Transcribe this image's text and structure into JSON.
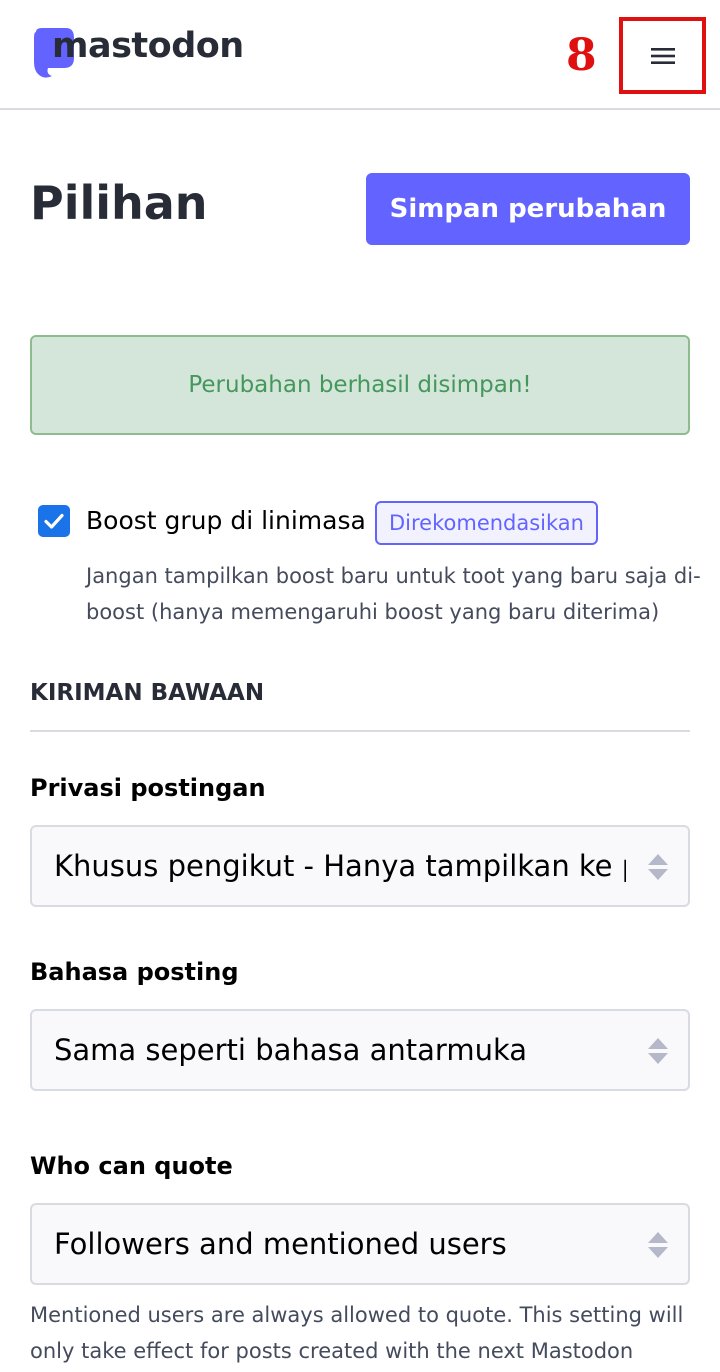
{
  "header": {
    "logo_text": "mastodon",
    "annotation_number": "8"
  },
  "page": {
    "title": "Pilihan",
    "save_button": "Simpan perubahan"
  },
  "flash": {
    "message": "Perubahan berhasil disimpan!"
  },
  "boost_option": {
    "label": "Boost grup di linimasa",
    "badge": "Direkomendasikan",
    "checked": true,
    "hint": "Jangan tampilkan boost baru untuk toot yang baru saja di-boost (hanya memengaruhi boost yang baru diterima)"
  },
  "section": {
    "title": "KIRIMAN BAWAAN"
  },
  "fields": {
    "privacy": {
      "label": "Privasi postingan",
      "value": "Khusus pengikut - Hanya tampilkan ke pengikut"
    },
    "language": {
      "label": "Bahasa posting",
      "value": "Sama seperti bahasa antarmuka"
    },
    "quote": {
      "label": "Who can quote",
      "value": "Followers and mentioned users",
      "hint": "Mentioned users are always allowed to quote. This setting will only take effect for posts created with the next Mastodon"
    }
  },
  "colors": {
    "accent": "#6364ff",
    "annotation_red": "#e01010",
    "success_text": "#45975c",
    "success_bg": "#d3e6d9",
    "checkbox": "#1a73e8"
  },
  "icons": {
    "logo": "mastodon-logo-icon",
    "menu": "hamburger-menu-icon",
    "check": "checkmark-icon",
    "select": "select-arrows-icon"
  }
}
